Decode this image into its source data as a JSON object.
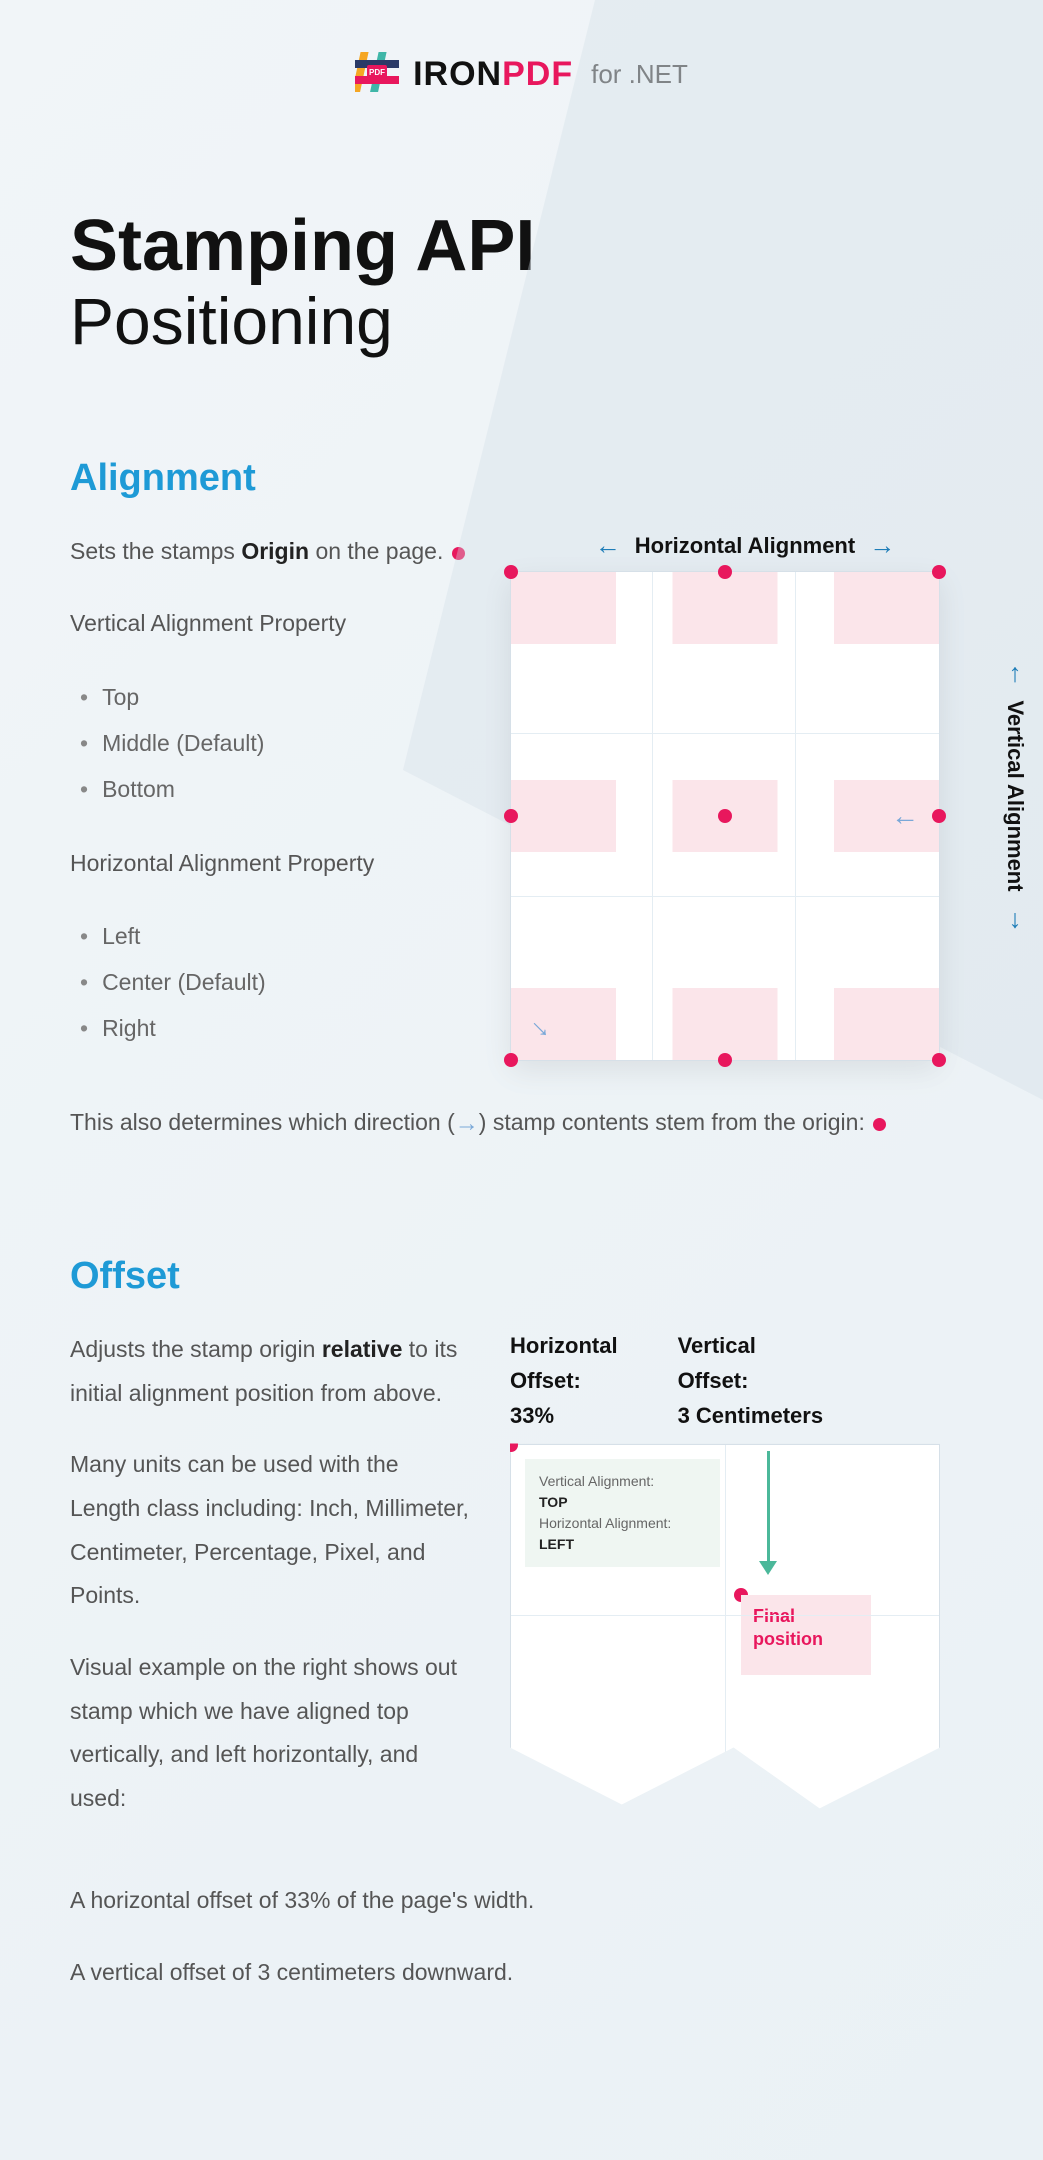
{
  "logo": {
    "iron": "IRON",
    "pdf": "PDF",
    "sub": "for .NET"
  },
  "title": {
    "line1": "Stamping API",
    "line2": "Positioning"
  },
  "alignment": {
    "heading": "Alignment",
    "intro_pre": "Sets the stamps ",
    "intro_bold": "Origin",
    "intro_post": " on the page. ",
    "vertical_title": "Vertical Alignment Property",
    "vertical_opts": [
      "Top",
      "Middle (Default)",
      "Bottom"
    ],
    "horizontal_title": "Horizontal Alignment Property",
    "horizontal_opts": [
      "Left",
      "Center (Default)",
      "Right"
    ],
    "footnote_pre": "This also determines which direction ",
    "footnote_post": " stamp contents stem from the origin: ",
    "graphic": {
      "h_axis": "Horizontal Alignment",
      "v_axis": "Vertical Alignment"
    }
  },
  "offset": {
    "heading": "Offset",
    "intro_pre": "Adjusts the stamp origin ",
    "intro_bold": "relative",
    "intro_post": " to its initial alignment position from above.",
    "units": "Many units can be used with the Length class including: Inch, Millimeter, Centimeter, Percentage, Pixel, and Points.",
    "example_lead": "Visual example on the right shows out stamp which we have aligned top vertically, and left horizontally, and used:",
    "bullet1": "A horizontal offset of 33% of the page's width.",
    "bullet2": "A vertical offset of 3 centimeters downward.",
    "graphic": {
      "h_label": {
        "line1": "Horizontal",
        "line2": "Offset:",
        "value": "33%"
      },
      "v_label": {
        "line1": "Vertical",
        "line2": "Offset:",
        "value": "3 Centimeters"
      },
      "info": {
        "v_label": "Vertical Alignment:",
        "v_value": "TOP",
        "h_label": "Horizontal Alignment:",
        "h_value": "LEFT"
      },
      "final": {
        "line1": "Final",
        "line2": "position"
      }
    }
  }
}
